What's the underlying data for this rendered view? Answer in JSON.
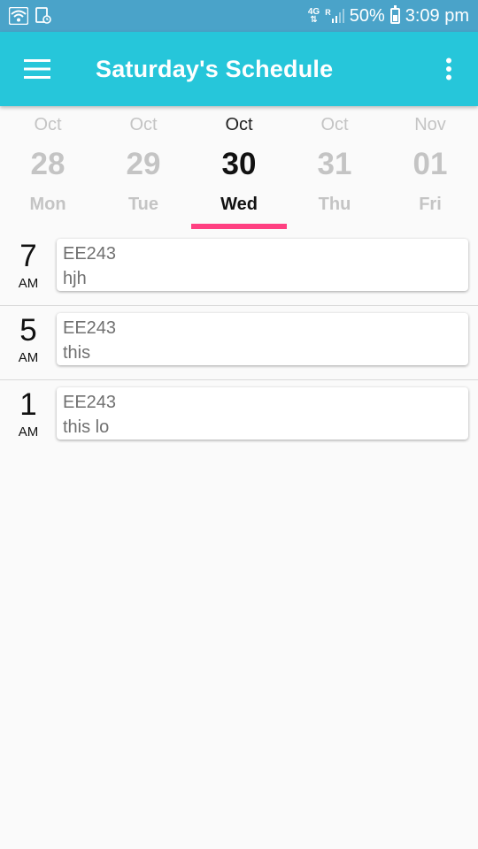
{
  "status_bar": {
    "network_type": "4G",
    "roaming": "R",
    "battery": "50%",
    "time": "3:09 pm",
    "icons": [
      "wifi-icon",
      "screenshot-notification-icon",
      "data-arrows-icon",
      "signal-icon",
      "battery-icon"
    ]
  },
  "app_bar": {
    "title": "Saturday's Schedule",
    "menu_icon": "hamburger-menu-icon",
    "overflow_icon": "more-vert-icon",
    "color": "#26c6da"
  },
  "date_strip": {
    "days": [
      {
        "month": "Oct",
        "day": "28",
        "weekday": "Mon",
        "selected": false
      },
      {
        "month": "Oct",
        "day": "29",
        "weekday": "Tue",
        "selected": false
      },
      {
        "month": "Oct",
        "day": "30",
        "weekday": "Wed",
        "selected": true
      },
      {
        "month": "Oct",
        "day": "31",
        "weekday": "Thu",
        "selected": false
      },
      {
        "month": "Nov",
        "day": "01",
        "weekday": "Fri",
        "selected": false
      }
    ],
    "indicator_color": "#ff4081"
  },
  "schedule": [
    {
      "hour": "7",
      "ampm": "AM",
      "course": "EE243",
      "note": "hjh"
    },
    {
      "hour": "5",
      "ampm": "AM",
      "course": "EE243",
      "note": "this"
    },
    {
      "hour": "1",
      "ampm": "AM",
      "course": "EE243",
      "note": "this lo"
    }
  ]
}
